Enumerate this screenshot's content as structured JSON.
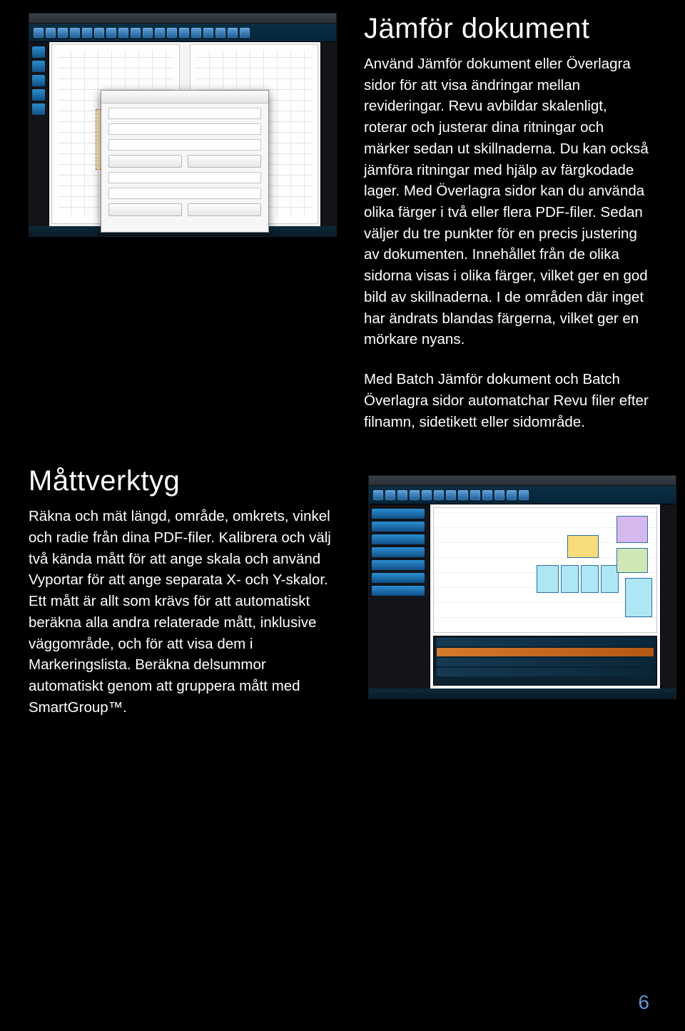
{
  "section1": {
    "heading": "Jämför dokument",
    "p1": "Använd Jämför dokument eller Överlagra sidor för att visa ändringar mellan revideringar. Revu avbildar skalenligt, roterar och justerar dina ritningar och märker sedan ut skillnaderna. Du kan också jämföra ritningar med hjälp av färgkodade lager. Med Överlagra sidor kan du använda olika färger i två eller flera PDF-filer. Sedan väljer du tre punkter för en precis justering av dokumenten. Innehållet från de olika sidorna visas i olika färger, vilket ger en god bild av skillnaderna. I de områden där inget har ändrats blandas färgerna, vilket ger en mörkare nyans.",
    "p2": "Med Batch Jämför dokument och Batch Överlagra sidor automatchar Revu filer efter filnamn, sidetikett eller sidområde."
  },
  "section2": {
    "heading": "Måttverktyg",
    "p1": "Räkna och mät längd, område, omkrets, vinkel och radie från dina PDF-filer. Kalibrera och välj två kända mått för att ange skala och använd Vyportar för att ange separata X- och Y-skalor. Ett mått är allt som krävs för att automatiskt beräkna alla andra relaterade mått, inklusive väggområde, och för att visa dem i Markeringslista. Beräkna delsummor automatiskt genom att gruppera mått med SmartGroup™."
  },
  "page_number": "6"
}
